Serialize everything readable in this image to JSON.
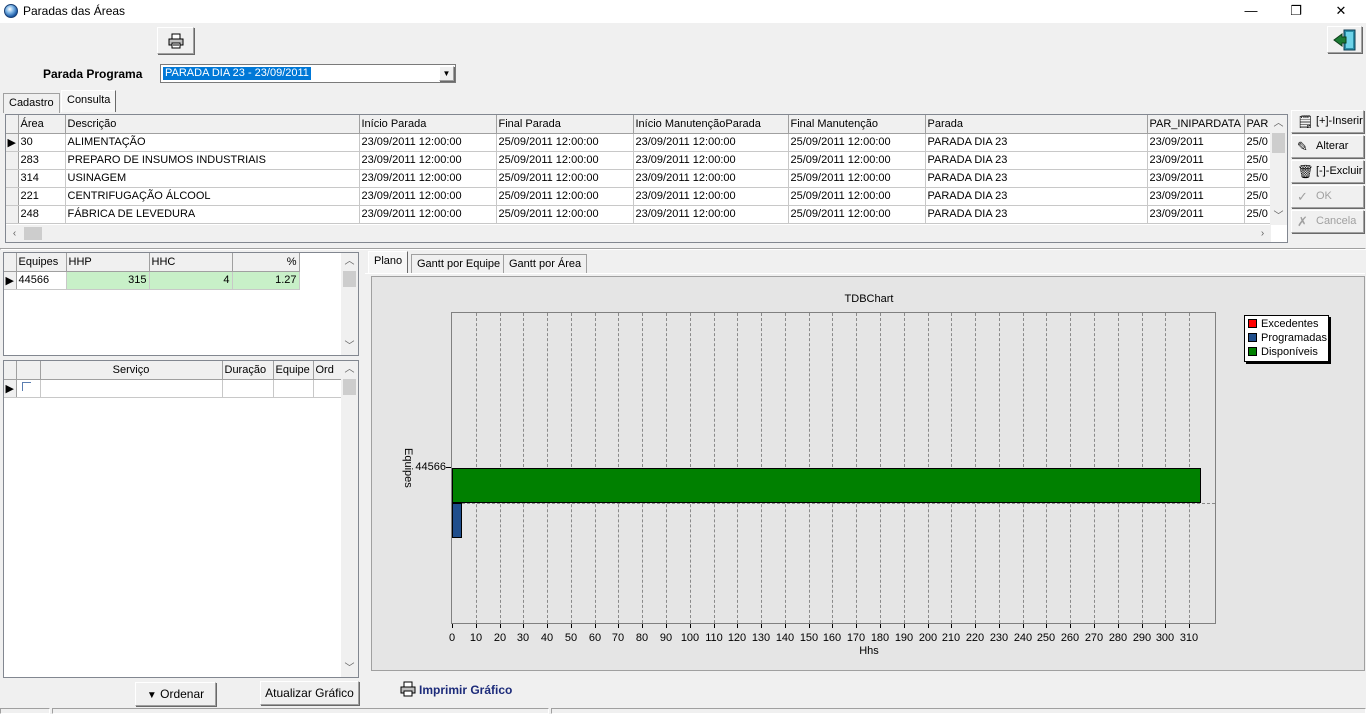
{
  "window": {
    "title": "Paradas das Áreas",
    "minimize_glyph": "—",
    "restore_glyph": "❐",
    "close_glyph": "✕"
  },
  "toolbar": {
    "print_icon": "printer-icon",
    "exit_icon": "exit-door-icon"
  },
  "parada_programa": {
    "label": "Parada Programa",
    "value": "PARADA DIA 23 - 23/09/2011"
  },
  "tabs_top": [
    {
      "label": "Cadastro"
    },
    {
      "label": "Consulta"
    }
  ],
  "main_grid": {
    "columns": [
      "Área",
      "Descrição",
      "Início Parada",
      "Final Parada",
      "Início ManutençãoParada",
      "Final Manutenção",
      "Parada",
      "PAR_INIPARDATA",
      "PAR"
    ],
    "rows": [
      [
        "30",
        "ALIMENTAÇÃO",
        "23/09/2011 12:00:00",
        "25/09/2011 12:00:00",
        "23/09/2011 12:00:00",
        "25/09/2011 12:00:00",
        "PARADA DIA 23",
        "23/09/2011",
        "25/0"
      ],
      [
        "283",
        "PREPARO DE INSUMOS INDUSTRIAIS",
        "23/09/2011 12:00:00",
        "25/09/2011 12:00:00",
        "23/09/2011 12:00:00",
        "25/09/2011 12:00:00",
        "PARADA DIA 23",
        "23/09/2011",
        "25/0"
      ],
      [
        "314",
        "USINAGEM",
        "23/09/2011 12:00:00",
        "25/09/2011 12:00:00",
        "23/09/2011 12:00:00",
        "25/09/2011 12:00:00",
        "PARADA DIA 23",
        "23/09/2011",
        "25/0"
      ],
      [
        "221",
        "CENTRIFUGAÇÃO ÁLCOOL",
        "23/09/2011 12:00:00",
        "25/09/2011 12:00:00",
        "23/09/2011 12:00:00",
        "25/09/2011 12:00:00",
        "PARADA DIA 23",
        "23/09/2011",
        "25/0"
      ],
      [
        "248",
        "FÁBRICA DE LEVEDURA",
        "23/09/2011 12:00:00",
        "25/09/2011 12:00:00",
        "23/09/2011 12:00:00",
        "25/09/2011 12:00:00",
        "PARADA DIA 23",
        "23/09/2011",
        "25/0"
      ]
    ]
  },
  "side_buttons": {
    "inserir": "[+]-Inserir",
    "alterar": "Alterar",
    "excluir": "[-]-Excluir",
    "ok": "OK",
    "cancela": "Cancela"
  },
  "equipes_grid": {
    "columns": [
      "Equipes",
      "HHP",
      "HHC",
      "%"
    ],
    "rows": [
      [
        "44566",
        "315",
        "4",
        "1.27"
      ]
    ]
  },
  "servico_grid": {
    "columns": [
      "Serviço",
      "Duração",
      "Equipe",
      "Ord"
    ]
  },
  "bottom_buttons": {
    "ordenar": "Ordenar",
    "atualizar": "Atualizar Gráfico"
  },
  "chart_tabs": [
    {
      "label": "Plano"
    },
    {
      "label": "Gantt por Equipe"
    },
    {
      "label": "Gantt por Área"
    }
  ],
  "print_chart": {
    "label": "Imprimir Gráfico"
  },
  "colors": {
    "excedentes": "#ff0000",
    "programadas": "#1f4e8c",
    "disponiveis": "#008000",
    "selection": "#0078d7",
    "row_highlight": "#c8f0c8"
  },
  "chart_data": {
    "type": "bar",
    "orientation": "horizontal",
    "title": "TDBChart",
    "xlabel": "Hhs",
    "ylabel": "Equipes",
    "categories": [
      "44566"
    ],
    "series": [
      {
        "name": "Excedentes",
        "values": [
          0
        ]
      },
      {
        "name": "Programadas",
        "values": [
          4
        ]
      },
      {
        "name": "Disponíveis",
        "values": [
          315
        ]
      }
    ],
    "xlim": [
      0,
      315
    ],
    "x_ticks": [
      0,
      10,
      20,
      30,
      40,
      50,
      60,
      70,
      80,
      90,
      100,
      110,
      120,
      130,
      140,
      150,
      160,
      170,
      180,
      190,
      200,
      210,
      220,
      230,
      240,
      250,
      260,
      270,
      280,
      290,
      300,
      310
    ],
    "grid": true,
    "legend": "top-right"
  }
}
